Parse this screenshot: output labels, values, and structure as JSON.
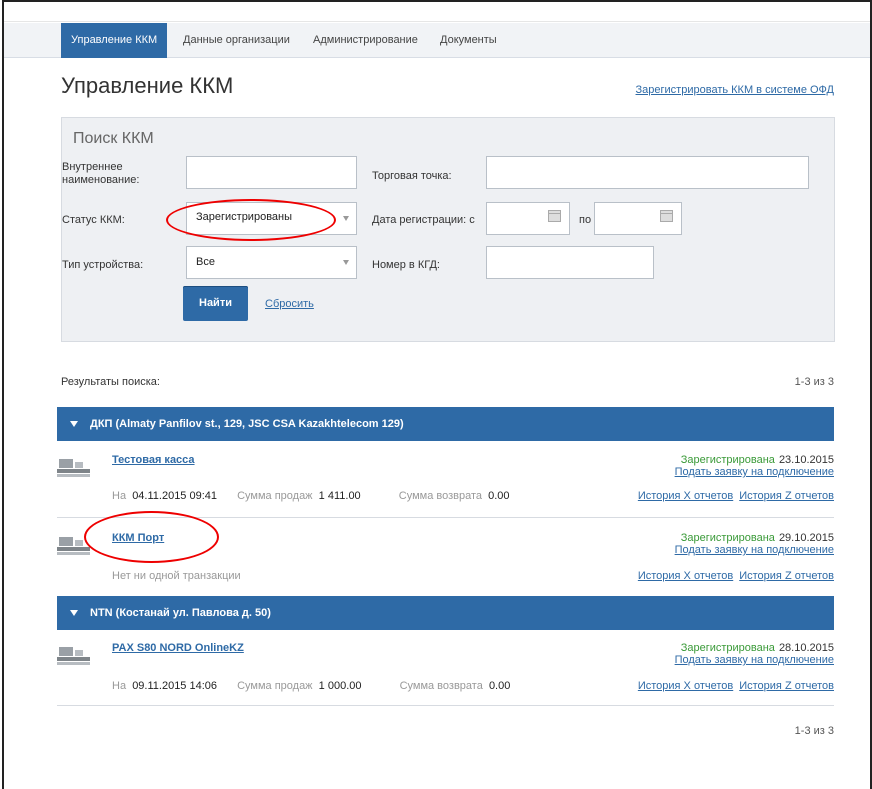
{
  "nav": {
    "tabs": [
      "Управление ККМ",
      "Данные организации",
      "Администрирование",
      "Документы"
    ]
  },
  "page": {
    "title": "Управление ККМ",
    "register_link": "Зарегистрировать ККМ в системе ОФД"
  },
  "search": {
    "title": "Поиск ККМ",
    "internal_name_label": "Внутреннее наименование:",
    "trade_point_label": "Торговая точка:",
    "status_label": "Статус ККМ:",
    "status_value": "Зарегистрированы",
    "reg_date_label": "Дата регистрации: с",
    "reg_date_to": "по",
    "device_type_label": "Тип устройства:",
    "device_type_value": "Все",
    "kgd_label": "Номер в КГД:",
    "find_button": "Найти",
    "reset_link": "Сбросить"
  },
  "results": {
    "label": "Результаты поиска:",
    "pager": "1-3 из 3",
    "groups": [
      {
        "title": "ДКП (Almaty Panfilov st., 129, JSC CSA Kazakhtelecom 129)",
        "items": [
          {
            "name": "Тестовая касса",
            "status": "Зарегистрирована",
            "date": "23.10.2015",
            "connect": "Подать заявку на подключение",
            "meta_on": "На",
            "meta_time": "04.11.2015 09:41",
            "sales_label": "Сумма продаж",
            "sales": "1 411.00",
            "refund_label": "Сумма возврата",
            "refund": "0.00",
            "hist_x": "История X отчетов",
            "hist_z": "История Z отчетов"
          },
          {
            "name": "ККМ Порт",
            "status": "Зарегистрирована",
            "date": "29.10.2015",
            "connect": "Подать заявку на подключение",
            "no_tx": "Нет ни одной транзакции",
            "hist_x": "История X отчетов",
            "hist_z": "История Z отчетов"
          }
        ]
      },
      {
        "title": "NTN (Костанай ул. Павлова д. 50)",
        "items": [
          {
            "name": "PAX S80 NORD OnlineKZ",
            "status": "Зарегистрирована",
            "date": "28.10.2015",
            "connect": "Подать заявку на подключение",
            "meta_on": "На",
            "meta_time": "09.11.2015 14:06",
            "sales_label": "Сумма продаж",
            "sales": "1 000.00",
            "refund_label": "Сумма возврата",
            "refund": "0.00",
            "hist_x": "История X отчетов",
            "hist_z": "История Z отчетов"
          }
        ]
      }
    ]
  },
  "colors": {
    "accent": "#2e6aa6",
    "status_green": "#3a9a38",
    "annotation_red": "#e00000"
  }
}
